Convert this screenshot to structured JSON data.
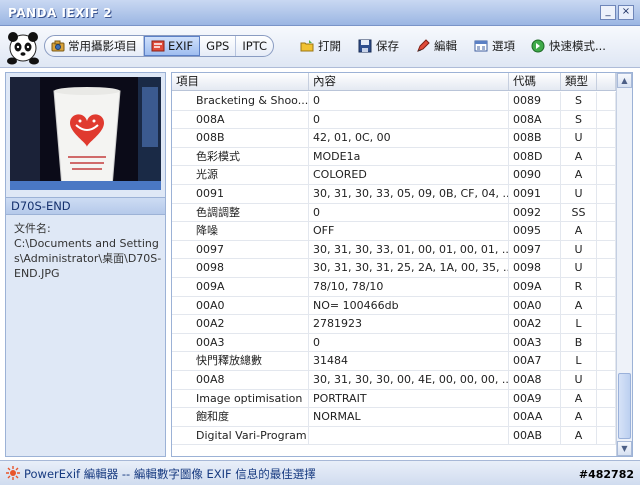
{
  "window": {
    "title": "PANDA IEXIF 2",
    "min_label": "_",
    "close_label": "×"
  },
  "toolbar": {
    "tabs": [
      {
        "label": "常用攝影項目",
        "icon": "camera-icon"
      },
      {
        "label": "EXIF",
        "icon": "exif-icon",
        "active": true
      },
      {
        "label": "GPS"
      },
      {
        "label": "IPTC"
      }
    ],
    "buttons": [
      {
        "label": "打開",
        "icon": "open-folder-icon"
      },
      {
        "label": "保存",
        "icon": "save-disk-icon"
      },
      {
        "label": "編輯",
        "icon": "edit-icon"
      },
      {
        "label": "選項",
        "icon": "options-icon"
      },
      {
        "label": "快速模式...",
        "icon": "quick-mode-icon"
      }
    ]
  },
  "file": {
    "name": "D70S-END",
    "label": "文件名:",
    "path": "C:\\Documents and Settings\\Administrator\\桌面\\D70S-END.JPG"
  },
  "table": {
    "headers": [
      "項目",
      "內容",
      "代碼",
      "類型"
    ],
    "rows": [
      [
        "Bracketing & Shoo...",
        "0",
        "0089",
        "S"
      ],
      [
        "008A",
        "0",
        "008A",
        "S"
      ],
      [
        "008B",
        "42, 01, 0C, 00",
        "008B",
        "U"
      ],
      [
        "色彩模式",
        "MODE1a",
        "008D",
        "A"
      ],
      [
        "光源",
        "COLORED",
        "0090",
        "A"
      ],
      [
        "0091",
        "30, 31, 30, 33, 05, 09, 0B, CF, 04, ...",
        "0091",
        "U"
      ],
      [
        "色調調整",
        "0",
        "0092",
        "SS"
      ],
      [
        "降噪",
        "OFF",
        "0095",
        "A"
      ],
      [
        "0097",
        "30, 31, 30, 33, 01, 00, 01, 00, 01, ...",
        "0097",
        "U"
      ],
      [
        "0098",
        "30, 31, 30, 31, 25, 2A, 1A, 00, 35, ...",
        "0098",
        "U"
      ],
      [
        "009A",
        "78/10, 78/10",
        "009A",
        "R"
      ],
      [
        "00A0",
        "NO= 100466db",
        "00A0",
        "A"
      ],
      [
        "00A2",
        "2781923",
        "00A2",
        "L"
      ],
      [
        "00A3",
        "0",
        "00A3",
        "B"
      ],
      [
        "快門釋放總數",
        "31484",
        "00A7",
        "L"
      ],
      [
        "00A8",
        "30, 31, 30, 30, 00, 4E, 00, 00, 00, ...",
        "00A8",
        "U"
      ],
      [
        "Image optimisation",
        "PORTRAIT",
        "00A9",
        "A"
      ],
      [
        "飽和度",
        "NORMAL",
        "00AA",
        "A"
      ],
      [
        "Digital Vari-Program",
        "",
        "00AB",
        "A"
      ]
    ]
  },
  "status": {
    "text": "PowerExif 編輯器 -- 編輯數字圖像 EXIF 信息的最佳選擇",
    "watermark": "#482782"
  },
  "colors": {
    "accent": "#14306d",
    "titlebar": "#9bb6e3"
  }
}
